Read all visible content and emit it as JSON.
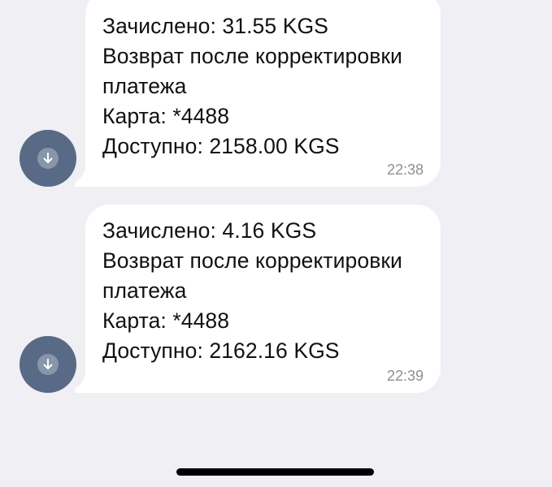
{
  "messages": [
    {
      "lines": [
        "Зачислено: 31.55 KGS",
        "Возврат после корректировки",
        "платежа",
        "Карта: *4488",
        "Доступно: 2158.00 KGS"
      ],
      "time": "22:38",
      "avatar_icon": "arrow-down-icon"
    },
    {
      "lines": [
        "Зачислено: 4.16 KGS",
        "Возврат после корректировки",
        "платежа",
        "Карта: *4488",
        "Доступно: 2162.16 KGS"
      ],
      "time": "22:39",
      "avatar_icon": "arrow-down-icon"
    }
  ],
  "colors": {
    "background": "#efeff4",
    "bubble": "#ffffff",
    "avatar": "#586a85",
    "time_text": "#8e8e93"
  }
}
